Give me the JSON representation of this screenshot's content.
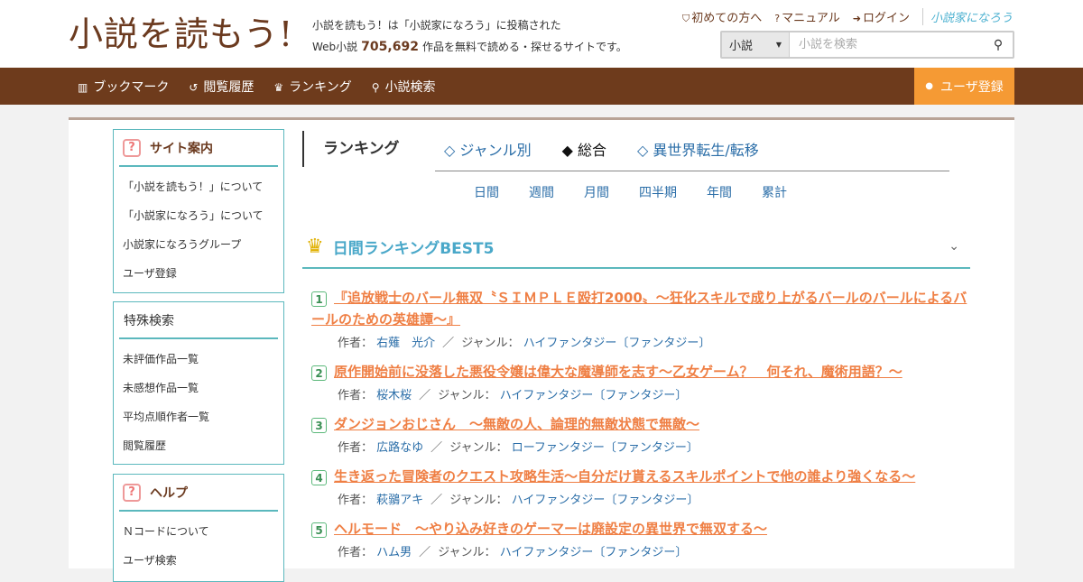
{
  "header": {
    "logo": "小説を読もう!",
    "tagline1": "小説を読もう！は「小説家になろう」に投稿された",
    "tagline2_pre": "Web小説",
    "work_count": "705,692",
    "tagline2_post": "作品を無料で読める・探せるサイトです。",
    "links": [
      {
        "icon": "shield-icon",
        "glyph": "⛉",
        "label": "初めての方へ"
      },
      {
        "icon": "help-icon",
        "glyph": "?",
        "label": "マニュアル"
      },
      {
        "icon": "login-icon",
        "glyph": "➜",
        "label": "ログイン"
      }
    ],
    "narou_logo": "小説家になろう",
    "search": {
      "select_value": "小説",
      "placeholder": "小説を検索"
    }
  },
  "nav": {
    "items": [
      {
        "icon": "bookshelf-icon",
        "glyph": "▥",
        "label": "ブックマーク"
      },
      {
        "icon": "history-icon",
        "glyph": "↺",
        "label": "閲覧履歴"
      },
      {
        "icon": "crown-icon",
        "glyph": "♛",
        "label": "ランキング"
      },
      {
        "icon": "search-icon",
        "glyph": "⚲",
        "label": "小説検索"
      }
    ],
    "register": {
      "icon": "user-icon",
      "glyph": "●",
      "label": "ユーザ登録"
    }
  },
  "sidebar": {
    "guide": {
      "title": "サイト案内",
      "items": [
        "「小説を読もう！」について",
        "「小説家になろう」について",
        "小説家になろうグループ",
        "ユーザ登録"
      ]
    },
    "special": {
      "title": "特殊検索",
      "items": [
        "未評価作品一覧",
        "未感想作品一覧",
        "平均点順作者一覧",
        "閲覧履歴"
      ]
    },
    "help": {
      "title": "ヘルプ",
      "items": [
        "Ｎコードについて",
        "ユーザ検索"
      ]
    }
  },
  "ranking": {
    "title": "ランキング",
    "tabs": [
      "◇ ジャンル別",
      "◆ 総合",
      "◇ 異世界転生/転移"
    ],
    "periods": [
      "日間",
      "週間",
      "月間",
      "四半期",
      "年間",
      "累計"
    ],
    "best_title": "日間ランキングBEST5",
    "author_label": "作者：",
    "genre_label": "ジャンル：",
    "entries": [
      {
        "rank": "1",
        "title": "『追放戦士のバール無双〝ＳＩＭＰＬＥ殴打2000〟～狂化スキルで成り上がるバールのバールによるバールのための英雄譚～』",
        "author": "右薙　光介",
        "genre": "ハイファンタジー〔ファンタジー〕"
      },
      {
        "rank": "2",
        "title": "原作開始前に没落した悪役令嬢は偉大な魔導師を志す～乙女ゲーム？　何それ、魔術用語？～",
        "author": "桜木桜",
        "genre": "ハイファンタジー〔ファンタジー〕"
      },
      {
        "rank": "3",
        "title": "ダンジョンおじさん　～無敵の人、論理的無敵状態で無敵～",
        "author": "広路なゆ",
        "genre": "ローファンタジー〔ファンタジー〕"
      },
      {
        "rank": "4",
        "title": "生き返った冒険者のクエスト攻略生活～自分だけ貰えるスキルポイントで他の誰より強くなる～",
        "author": "萩鶸アキ",
        "genre": "ハイファンタジー〔ファンタジー〕"
      },
      {
        "rank": "5",
        "title": "ヘルモード　～やり込み好きのゲーマーは廃設定の異世界で無双する～",
        "author": "ハム男",
        "genre": "ハイファンタジー〔ファンタジー〕"
      }
    ]
  }
}
